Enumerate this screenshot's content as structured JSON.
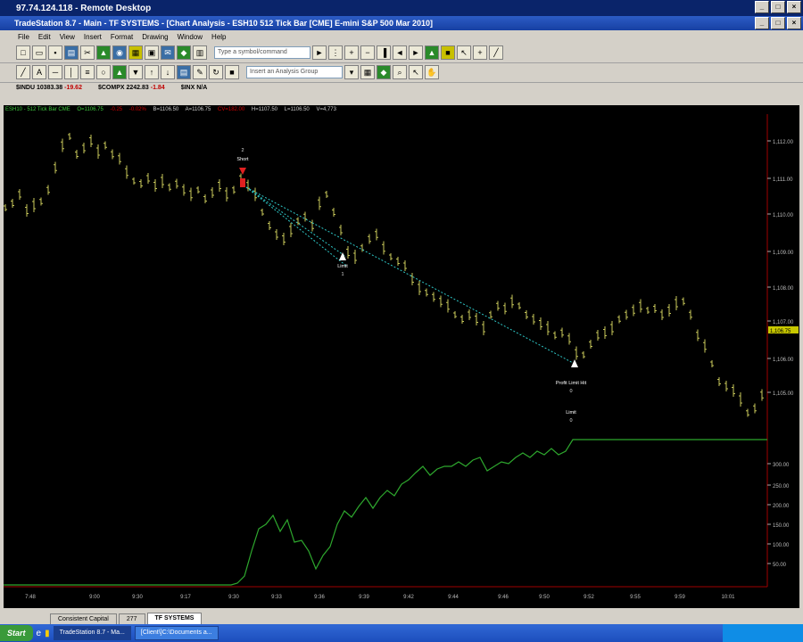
{
  "remote_desktop": {
    "title": "97.74.124.118 - Remote Desktop"
  },
  "app": {
    "title": "TradeStation 8.7 - Main - TF SYSTEMS - [Chart Analysis - ESH10 512 Tick Bar [CME] E-mini S&P 500 Mar 2010]"
  },
  "menu": [
    "File",
    "Edit",
    "View",
    "Insert",
    "Format",
    "Drawing",
    "Window",
    "Help"
  ],
  "toolbar": {
    "symbol_placeholder": "Type a symbol/command",
    "analysis_placeholder": "Insert an Analysis Group"
  },
  "ticker_bar": [
    {
      "symbol": "$INDU 10383.38",
      "change": "-19.62"
    },
    {
      "symbol": "$COMPX 2242.83",
      "change": "-1.84"
    },
    {
      "symbol": "$INX N/A",
      "change": ""
    }
  ],
  "chart": {
    "header_symbol": "ESH10 - 512 Tick Bar CME",
    "header_open": "O=1106.75",
    "header_neg": "-0.25",
    "header_pct": "-0.02%",
    "header_b": "B=1106.50",
    "header_a": "A=1106.75",
    "header_vol_red": "CV=182.00",
    "header_h": "H=1107.50",
    "header_l": "L=1106.50",
    "header_v": "V=4,773",
    "price_labels": [
      "1,112.00",
      "1,111.00",
      "1,110.00",
      "1,109.00",
      "1,108.00",
      "1,107.00",
      "1,106.00",
      "1,105.00"
    ],
    "current_price_tag": "1,106.75",
    "equity_labels": [
      "300.00",
      "250.00",
      "200.00",
      "150.00",
      "100.00",
      "50.00"
    ],
    "time_labels": [
      "7:48",
      "9:00",
      "9:30",
      "9:17",
      "9:30",
      "9:33",
      "9:36",
      "9:39",
      "9:42",
      "9:44",
      "9:46",
      "9:50",
      "9:52",
      "9:55",
      "9:59",
      "10:01"
    ],
    "annotations": {
      "short_label": "Short",
      "short_qty": "2",
      "limit1_label": "Limit",
      "limit1_qty": "1",
      "profit_label": "Profit Limit Hit",
      "profit_qty": "0",
      "limit2_label": "Limit",
      "limit2_qty": "0"
    },
    "colors": {
      "bars": "#c8c85a",
      "equity": "#2ea82e",
      "trendline": "#2ec8c8",
      "price_tag": "#c8c800"
    }
  },
  "workspace_tabs": [
    "Consistent Capital",
    "277",
    "TF SYSTEMS"
  ],
  "taskbar": {
    "start": "Start",
    "tasks": [
      "TradeStation 8.7 - Ma...",
      "[Client\\]C:\\Documents a..."
    ]
  }
}
